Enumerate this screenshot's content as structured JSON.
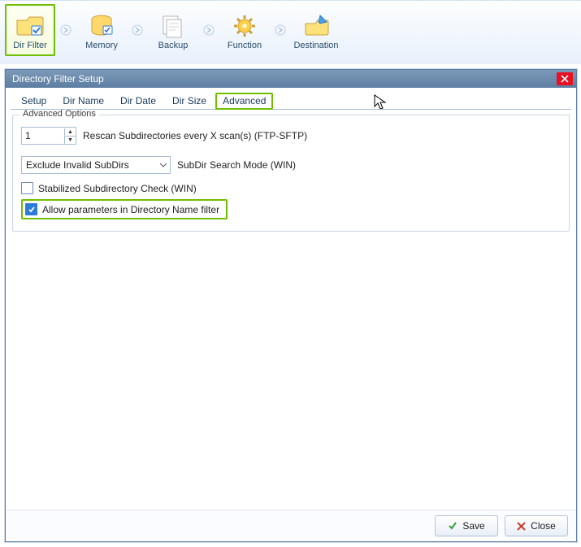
{
  "ribbon": {
    "steps": [
      {
        "label": "Dir Filter"
      },
      {
        "label": "Memory"
      },
      {
        "label": "Backup"
      },
      {
        "label": "Function"
      },
      {
        "label": "Destination"
      }
    ]
  },
  "dialog": {
    "title": "Directory Filter Setup",
    "tabs": [
      "Setup",
      "Dir Name",
      "Dir Date",
      "Dir Size",
      "Advanced"
    ],
    "active_tab": "Advanced"
  },
  "advanced": {
    "legend": "Advanced Options",
    "rescan_value": "1",
    "rescan_label": "Rescan Subdirectories every X scan(s) (FTP-SFTP)",
    "subdir_mode_value": "Exclude Invalid SubDirs",
    "subdir_mode_label": "SubDir Search Mode (WIN)",
    "stabilized_label": "Stabilized Subdirectory Check (WIN)",
    "stabilized_checked": false,
    "allow_params_label": "Allow parameters in Directory Name filter",
    "allow_params_checked": true
  },
  "footer": {
    "save": "Save",
    "close": "Close"
  },
  "colors": {
    "highlight": "#6FBF00",
    "titlebar": "#6a8aad",
    "close": "#e81123"
  }
}
